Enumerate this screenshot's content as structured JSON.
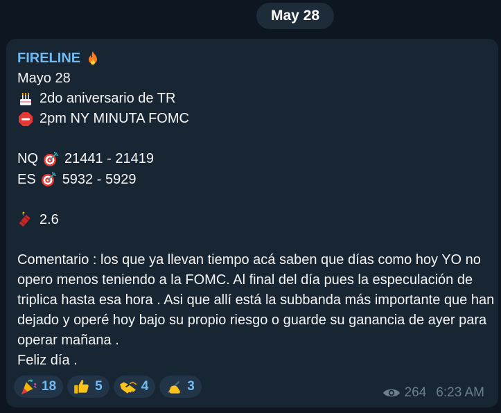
{
  "date_separator": "May 28",
  "message": {
    "author": "FIRELINE",
    "author_emoji": "fire-icon",
    "lines": {
      "date": "Mayo 28",
      "anniversary": "2do aniversario de TR",
      "fomc": "2pm NY MINUTA FOMC",
      "nq_label": "NQ",
      "nq_range": "21441 - 21419",
      "es_label": "ES",
      "es_range": "5932 - 5929",
      "dynamite_value": "2.6",
      "comment": "Comentario : los que ya llevan tiempo acá saben que días como hoy YO no opero menos teniendo a la FOMC. Al final del día pues la especulación de triplica hasta esa hora . Asi que allí está la subbanda más importante que han dejado y operé hoy bajo su propio riesgo o guarde su ganancia de ayer para operar mañana .",
      "closing": "Feliz día ."
    },
    "icons": {
      "anniversary": "birthday-cake-icon",
      "fomc": "stop-sign-icon",
      "target": "direct-hit-target-icon",
      "dynamite": "firecracker-icon"
    }
  },
  "reactions": [
    {
      "icon": "party-popper-icon",
      "count": "18"
    },
    {
      "icon": "thumbs-up-icon",
      "count": "5"
    },
    {
      "icon": "handshake-icon",
      "count": "4"
    },
    {
      "icon": "writing-hand-icon",
      "count": "3"
    }
  ],
  "meta": {
    "views": "264",
    "time": "6:23 AM"
  },
  "colors": {
    "background": "#0e1621",
    "bubble": "#182533",
    "author": "#71baf2",
    "text": "#f5f5f5",
    "reaction_bg": "#213448",
    "meta": "#6d7f8f"
  }
}
